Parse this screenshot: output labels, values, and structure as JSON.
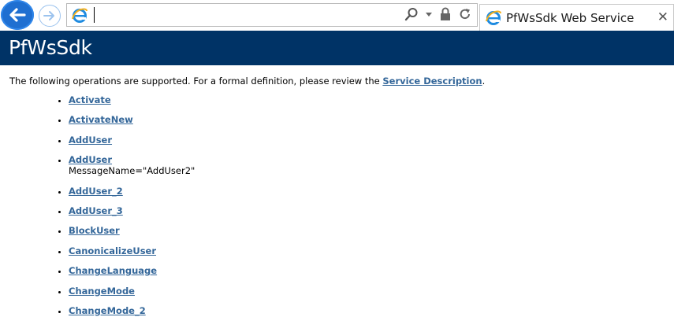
{
  "browser": {
    "address_value": "",
    "tab_title": "PfWsSdk Web Service",
    "tab_close": "✕"
  },
  "page": {
    "heading": "PfWsSdk",
    "intro_text": "The following operations are supported. For a formal definition, please review the ",
    "intro_link": "Service Description",
    "intro_end": ".",
    "operations": [
      {
        "label": "Activate"
      },
      {
        "label": "ActivateNew"
      },
      {
        "label": "AddUser"
      },
      {
        "label": "AddUser",
        "message_name": "MessageName=\"AddUser2\""
      },
      {
        "label": "AddUser_2"
      },
      {
        "label": "AddUser_3"
      },
      {
        "label": "BlockUser"
      },
      {
        "label": "CanonicalizeUser"
      },
      {
        "label": "ChangeLanguage"
      },
      {
        "label": "ChangeMode"
      },
      {
        "label": "ChangeMode_2"
      }
    ]
  },
  "colors": {
    "heading_bg": "#003366",
    "link": "#336699",
    "back_button": "#1f6fd1"
  }
}
